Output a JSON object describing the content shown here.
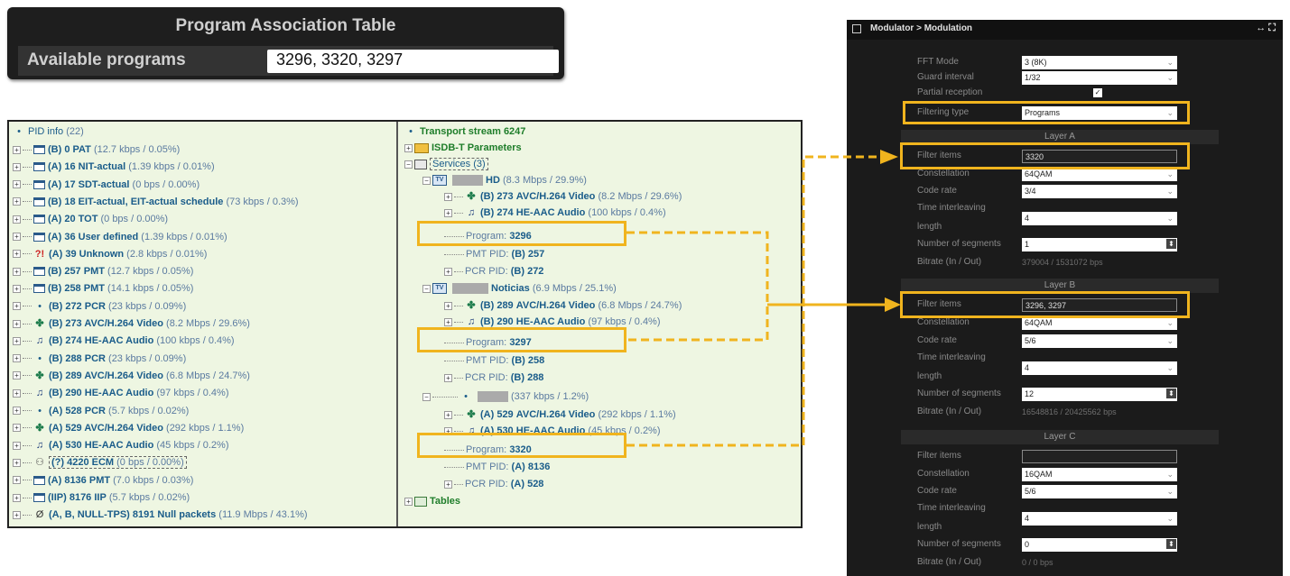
{
  "pat": {
    "title": "Program Association Table",
    "label": "Available programs",
    "value": "3296, 3320, 3297"
  },
  "pid_tree": {
    "root": "PID info",
    "root_count": "(22)",
    "items": [
      {
        "icon": "table-icon",
        "tag": "(B) 0",
        "name": "PAT",
        "rate": "(12.7 kbps / 0.05%)"
      },
      {
        "icon": "table-icon",
        "tag": "(A) 16",
        "name": "NIT-actual",
        "rate": "(1.39 kbps / 0.01%)"
      },
      {
        "icon": "table-icon",
        "tag": "(A) 17",
        "name": "SDT-actual",
        "rate": "(0 bps / 0.00%)"
      },
      {
        "icon": "table-icon",
        "tag": "(B) 18",
        "name": "EIT-actual, EIT-actual schedule",
        "rate": "(73 kbps / 0.3%)"
      },
      {
        "icon": "table-icon",
        "tag": "(A) 20",
        "name": "TOT",
        "rate": "(0 bps / 0.00%)"
      },
      {
        "icon": "table-icon",
        "tag": "(A) 36",
        "name": "User defined",
        "rate": "(1.39 kbps / 0.01%)"
      },
      {
        "icon": "unknown-icon",
        "tag": "(A) 39",
        "name": "Unknown",
        "rate": "(2.8 kbps / 0.01%)"
      },
      {
        "icon": "table-icon",
        "tag": "(B) 257",
        "name": "PMT",
        "rate": "(12.7 kbps / 0.05%)"
      },
      {
        "icon": "table-icon",
        "tag": "(B) 258",
        "name": "PMT",
        "rate": "(14.1 kbps / 0.05%)"
      },
      {
        "icon": "pcr-dot-icon",
        "tag": "(B) 272",
        "name": "PCR",
        "rate": "(23 kbps / 0.09%)"
      },
      {
        "icon": "video-icon",
        "tag": "(B) 273",
        "name": "AVC/H.264 Video",
        "rate": "(8.2 Mbps / 29.6%)"
      },
      {
        "icon": "audio-icon",
        "tag": "(B) 274",
        "name": "HE-AAC Audio",
        "rate": "(100 kbps / 0.4%)"
      },
      {
        "icon": "pcr-dot-icon",
        "tag": "(B) 288",
        "name": "PCR",
        "rate": "(23 kbps / 0.09%)"
      },
      {
        "icon": "video-icon",
        "tag": "(B) 289",
        "name": "AVC/H.264 Video",
        "rate": "(6.8 Mbps / 24.7%)"
      },
      {
        "icon": "audio-icon",
        "tag": "(B) 290",
        "name": "HE-AAC Audio",
        "rate": "(97 kbps / 0.4%)"
      },
      {
        "icon": "pcr-dot-icon",
        "tag": "(A) 528",
        "name": "PCR",
        "rate": "(5.7 kbps / 0.02%)"
      },
      {
        "icon": "video-icon",
        "tag": "(A) 529",
        "name": "AVC/H.264 Video",
        "rate": "(292 kbps / 1.1%)"
      },
      {
        "icon": "audio-icon",
        "tag": "(A) 530",
        "name": "HE-AAC Audio",
        "rate": "(45 kbps / 0.2%)"
      },
      {
        "icon": "ecm-icon",
        "tag": "(?) 4220",
        "name": "ECM",
        "rate": "(0 bps / 0.00%)"
      },
      {
        "icon": "table-icon",
        "tag": "(A) 8136",
        "name": "PMT",
        "rate": "(7.0 kbps / 0.03%)"
      },
      {
        "icon": "table-icon",
        "tag": "(IIP) 8176",
        "name": "IIP",
        "rate": "(5.7 kbps / 0.02%)"
      },
      {
        "icon": "null-icon",
        "tag": "(A, B, NULL-TPS) 8191",
        "name": "Null packets",
        "rate": "(11.9 Mbps / 43.1%)"
      }
    ]
  },
  "ts_tree": {
    "root": "Transport stream",
    "root_id": "6247",
    "isdb": "ISDB-T Parameters",
    "services": "Services",
    "services_count": "(3)",
    "svc1": {
      "name": "HD",
      "rate": "(8.3 Mbps / 29.9%)",
      "video": {
        "tag": "(B) 273",
        "name": "AVC/H.264 Video",
        "rate": "(8.2 Mbps / 29.6%)"
      },
      "audio": {
        "tag": "(B) 274",
        "name": "HE-AAC Audio",
        "rate": "(100 kbps / 0.4%)"
      },
      "program_label": "Program:",
      "program": "3296",
      "pmt_label": "PMT PID:",
      "pmt": "(B) 257",
      "pcr_label": "PCR PID:",
      "pcr": "(B) 272"
    },
    "svc2": {
      "name": "Noticias",
      "rate": "(6.9 Mbps / 25.1%)",
      "video": {
        "tag": "(B) 289",
        "name": "AVC/H.264 Video",
        "rate": "(6.8 Mbps / 24.7%)"
      },
      "audio": {
        "tag": "(B) 290",
        "name": "HE-AAC Audio",
        "rate": "(97 kbps / 0.4%)"
      },
      "program_label": "Program:",
      "program": "3297",
      "pmt_label": "PMT PID:",
      "pmt": "(B) 258",
      "pcr_label": "PCR PID:",
      "pcr": "(B) 288"
    },
    "svc3": {
      "rate": "(337 kbps / 1.2%)",
      "video": {
        "tag": "(A) 529",
        "name": "AVC/H.264 Video",
        "rate": "(292 kbps / 1.1%)"
      },
      "audio": {
        "tag": "(A) 530",
        "name": "HE-AAC Audio",
        "rate": "(45 kbps / 0.2%)"
      },
      "program_label": "Program:",
      "program": "3320",
      "pmt_label": "PMT PID:",
      "pmt": "(A) 8136",
      "pcr_label": "PCR PID:",
      "pcr": "(A) 528"
    },
    "tables": "Tables"
  },
  "modulator": {
    "title": "Modulator > Modulation",
    "window_controls": "↔ ⛶",
    "fft_mode_label": "FFT Mode",
    "fft_mode": "3 (8K)",
    "guard_label": "Guard interval",
    "guard": "1/32",
    "partial_label": "Partial reception",
    "partial_checked": "✓",
    "filtering_label": "Filtering type",
    "filtering": "Programs",
    "layer_a": {
      "title": "Layer A",
      "filter_label": "Filter items",
      "filter": "3320",
      "constellation_label": "Constellation",
      "constellation": "64QAM",
      "code_rate_label": "Code rate",
      "code_rate": "3/4",
      "interleave_label_1": "Time interleaving",
      "interleave_label_2": "length",
      "interleave": "4",
      "segments_label": "Number of segments",
      "segments": "1",
      "bitrate_label": "Bitrate (In / Out)",
      "bitrate": "379004 / 1531072 bps"
    },
    "layer_b": {
      "title": "Layer B",
      "filter_label": "Filter items",
      "filter": "3296, 3297",
      "constellation_label": "Constellation",
      "constellation": "64QAM",
      "code_rate_label": "Code rate",
      "code_rate": "5/6",
      "interleave_label_1": "Time interleaving",
      "interleave_label_2": "length",
      "interleave": "4",
      "segments_label": "Number of segments",
      "segments": "12",
      "bitrate_label": "Bitrate (In / Out)",
      "bitrate": "16548816 / 20425562 bps"
    },
    "layer_c": {
      "title": "Layer C",
      "filter_label": "Filter items",
      "filter": "",
      "constellation_label": "Constellation",
      "constellation": "16QAM",
      "code_rate_label": "Code rate",
      "code_rate": "5/6",
      "interleave_label_1": "Time interleaving",
      "interleave_label_2": "length",
      "interleave": "4",
      "segments_label": "Number of segments",
      "segments": "0",
      "bitrate_label": "Bitrate (In / Out)",
      "bitrate": "0 / 0 bps"
    }
  },
  "colors": {
    "highlight": "#f0b41e",
    "tree_bg": "#eef6e2",
    "panel_bg": "#1b1b1b"
  }
}
